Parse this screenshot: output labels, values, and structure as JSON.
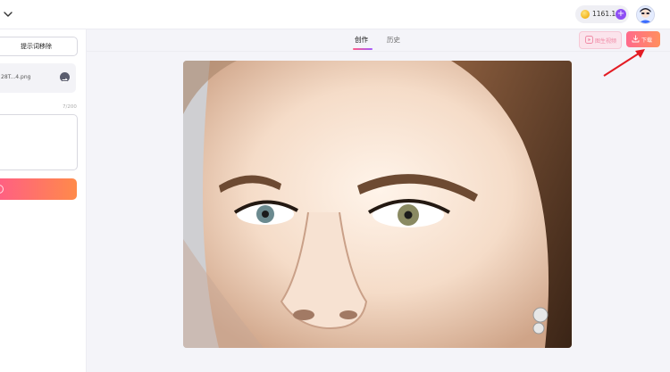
{
  "topbar": {
    "coin_balance": "1161.1",
    "add_symbol": "+"
  },
  "left_panel": {
    "remove_prompt_label": "提示词移除",
    "file_name": "28T...4.png",
    "char_count": "7/200"
  },
  "main": {
    "tabs": [
      {
        "label": "创作",
        "active": true
      },
      {
        "label": "历史",
        "active": false
      }
    ],
    "to_video_label": "图生视频",
    "download_label": "下载"
  },
  "colors": {
    "accent_gradient_start": "#ff5d86",
    "accent_gradient_end": "#ff8a4a",
    "purple": "#8e4ef4",
    "annotation_arrow": "#e31b23"
  }
}
